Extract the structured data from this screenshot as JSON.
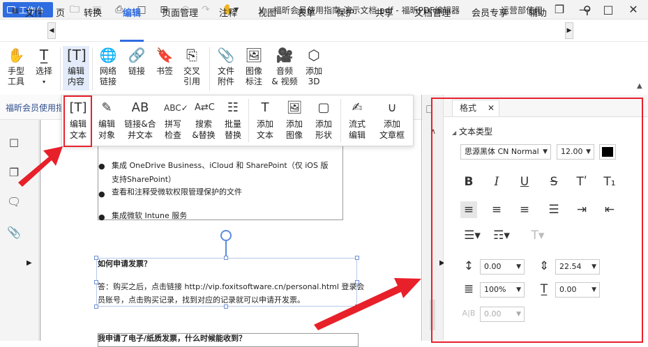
{
  "titlebar": {
    "workbench": "工作台",
    "doc_title": "福昕会员使用指南-演示文档.pdf - 福昕PDF编辑器",
    "department": "运营部使用"
  },
  "menubar": {
    "file": "文件",
    "items": [
      "页",
      "转换",
      "编辑",
      "页面管理",
      "注释",
      "视图",
      "表单",
      "保护",
      "共享",
      "文档管理",
      "会员专享",
      "辅助"
    ]
  },
  "ribbon": [
    {
      "label": "手型\n工具",
      "icon": "hand-icon"
    },
    {
      "label": "选择",
      "icon": "select-cursor-icon"
    },
    {
      "label": "编辑\n内容",
      "icon": "edit-content-icon"
    },
    {
      "label": "网络\n链接",
      "icon": "web-link-icon"
    },
    {
      "label": "链接",
      "icon": "link-icon"
    },
    {
      "label": "书签",
      "icon": "bookmark-icon"
    },
    {
      "label": "交叉\n引用",
      "icon": "cross-reference-icon"
    },
    {
      "label": "文件\n附件",
      "icon": "file-attachment-icon"
    },
    {
      "label": "图像\n标注",
      "icon": "image-annotation-icon"
    },
    {
      "label": "音频\n& 视频",
      "icon": "audio-video-icon"
    },
    {
      "label": "添加\n3D",
      "icon": "add-3d-icon"
    }
  ],
  "doc_tab": "福昕会员使用指",
  "popup": [
    {
      "label": "编辑\n文本",
      "icon": "edit-text-icon"
    },
    {
      "label": "编辑\n对象",
      "icon": "edit-object-icon"
    },
    {
      "label": "链接&合\n并文本",
      "icon": "link-merge-text-icon"
    },
    {
      "label": "拼写\n检查",
      "icon": "spell-check-icon"
    },
    {
      "label": "搜索\n&替换",
      "icon": "search-replace-icon"
    },
    {
      "label": "批量\n替换",
      "icon": "batch-replace-icon"
    },
    {
      "label": "添加\n文本",
      "icon": "add-text-icon"
    },
    {
      "label": "添加\n图像",
      "icon": "add-image-icon"
    },
    {
      "label": "添加\n形状",
      "icon": "add-shape-icon"
    },
    {
      "label": "流式\n编辑",
      "icon": "flow-edit-icon"
    },
    {
      "label": "添加\n文章框",
      "icon": "add-article-box-icon"
    }
  ],
  "document": {
    "bullet1": "集成 OneDrive Business、iCloud 和 SharePoint（仅 iOS 版",
    "bullet1b": "支持SharePoint）",
    "bullet2": "查看和注释受微软权限管理保护的文件",
    "bullet3": "集成微软 Intune 服务",
    "q1": "如何申请发票？",
    "a1_line1": "答：购买之后，点击链接 http://vip.foxitsoftware.cn/personal.html 登录会",
    "a1_line2": "员账号，点击购买记录，找到对应的记录就可以申请开发票。",
    "q2": "我申请了电子/纸质发票，什么时候能收到？"
  },
  "panel": {
    "tab": "格式",
    "section": "文本类型",
    "font": "思源黑体 CN Normal",
    "size": "12.00",
    "color": "#000000",
    "spacing1": "0.00",
    "spacing2": "22.54",
    "scale": "100%",
    "spacing3": "0.00",
    "spacing4": "0.00"
  },
  "colors": {
    "accent": "#2f6ce0",
    "annotation": "#e8202a"
  }
}
